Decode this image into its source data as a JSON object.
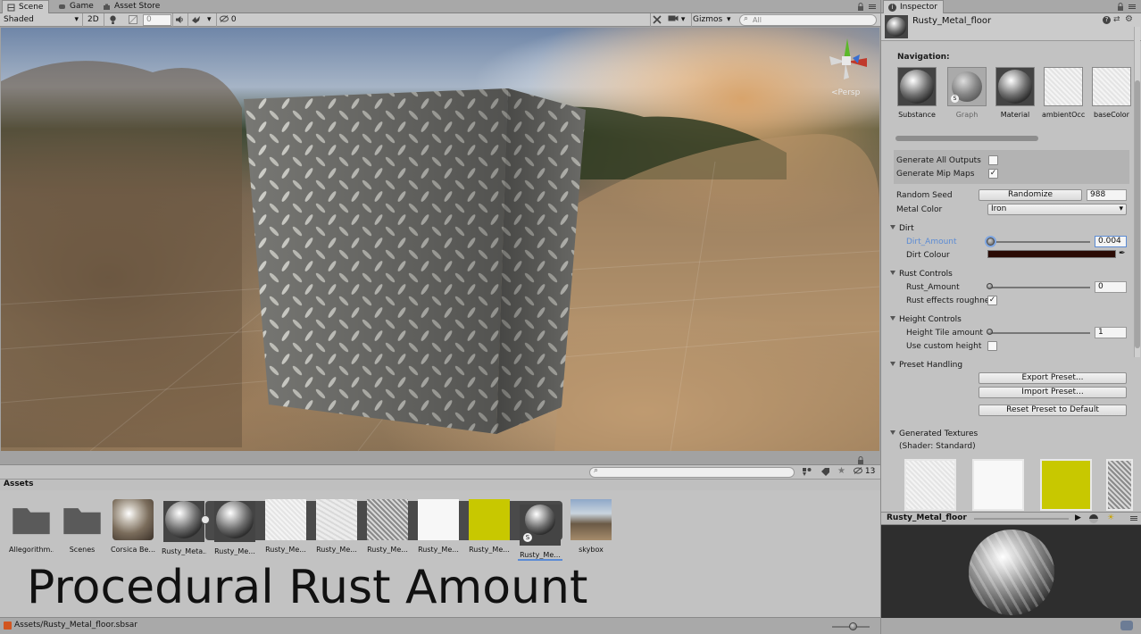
{
  "scene": {
    "tabs": [
      {
        "label": "Scene",
        "icon": "scene-icon",
        "active": true
      },
      {
        "label": "Game",
        "icon": "game-icon",
        "active": false
      },
      {
        "label": "Asset Store",
        "icon": "asset-store-icon",
        "active": false
      }
    ],
    "toolbar": {
      "shading_mode": "Shaded",
      "mode_2d": "2D",
      "scene_fx_count": "0",
      "hidden_count": "0",
      "gizmos_label": "Gizmos",
      "search_placeholder": "All"
    },
    "gizmo": {
      "projection": "Persp",
      "axis_x": "#c0392b",
      "axis_y": "#5cb82a",
      "axis_z": "#3a6fd0"
    }
  },
  "assets": {
    "title": "Assets",
    "hidden_count": "13",
    "items": [
      {
        "name": "Allegorithm...",
        "kind": "folder"
      },
      {
        "name": "Scenes",
        "kind": "folder"
      },
      {
        "name": "Corsica Be...",
        "kind": "hdr"
      },
      {
        "name": "Rusty_Meta...",
        "kind": "sphere"
      },
      {
        "name": "Rusty_Me...",
        "kind": "sphere"
      },
      {
        "name": "Rusty_Me...",
        "kind": "white-noise"
      },
      {
        "name": "Rusty_Me...",
        "kind": "light-noise"
      },
      {
        "name": "Rusty_Me...",
        "kind": "dark-noise"
      },
      {
        "name": "Rusty_Me...",
        "kind": "white"
      },
      {
        "name": "Rusty_Me...",
        "kind": "yellow"
      },
      {
        "name": "Rusty_Me...",
        "kind": "sphere-selected"
      },
      {
        "name": "skybox",
        "kind": "hdr"
      }
    ],
    "caption": "Procedural Rust Amount",
    "status_path": "Assets/Rusty_Metal_floor.sbsar"
  },
  "inspector": {
    "tab_label": "Inspector",
    "object_name": "Rusty_Metal_floor",
    "navigation_label": "Navigation:",
    "navigation": [
      {
        "label": "Substance"
      },
      {
        "label": "Graph"
      },
      {
        "label": "Material"
      },
      {
        "label": "ambientOcc"
      },
      {
        "label": "baseColor"
      }
    ],
    "generate_all_outputs": {
      "label": "Generate All Outputs",
      "checked": false
    },
    "generate_mip_maps": {
      "label": "Generate Mip Maps",
      "checked": true,
      "mark": "✓"
    },
    "random_seed": {
      "label": "Random Seed",
      "button": "Randomize",
      "value": "988"
    },
    "metal_color": {
      "label": "Metal Color",
      "value": "Iron"
    },
    "dirt": {
      "header": "Dirt",
      "amount_label": "Dirt_Amount",
      "amount_value": "0.004",
      "amount_fraction": 0.004,
      "colour_label": "Dirt Colour",
      "colour": "#2a0a04"
    },
    "rust": {
      "header": "Rust Controls",
      "amount_label": "Rust_Amount",
      "amount_value": "0",
      "effects_label": "Rust effects roughne",
      "effects_checked": true,
      "mark": "✓"
    },
    "height": {
      "header": "Height Controls",
      "tile_label": "Height Tile amount",
      "tile_value": "1",
      "custom_label": "Use custom height",
      "custom_checked": false
    },
    "preset": {
      "header": "Preset Handling",
      "export": "Export Preset...",
      "import": "Import Preset...",
      "reset": "Reset Preset to Default"
    },
    "generated": {
      "header": "Generated Textures",
      "shader": "(Shader: Standard)"
    },
    "preview_title": "Rusty_Metal_floor",
    "accent": "#5b8bd4",
    "yellow": "#c8c800"
  }
}
